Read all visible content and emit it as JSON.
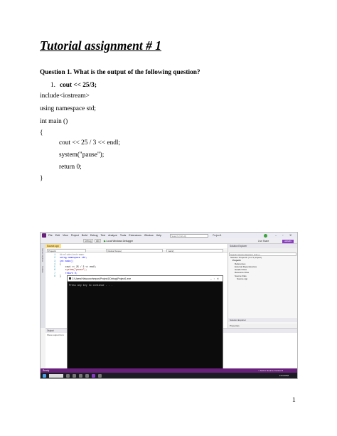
{
  "document": {
    "title": "Tutorial assignment # 1",
    "question": "Question 1. What is the output of the following question?",
    "list_item": {
      "number": "1.",
      "text": "cout << 25/3;"
    },
    "code_lines": [
      "include<iostream>",
      "using namespace std;",
      "int main ()",
      "{",
      "cout << 25 / 3 << endl;",
      "system(\"pause\");",
      "return 0;",
      "}"
    ],
    "page_number": "1"
  },
  "screenshot": {
    "menu_items": [
      "File",
      "Edit",
      "View",
      "Project",
      "Build",
      "Debug",
      "Test",
      "Analyze",
      "Tools",
      "Extensions",
      "Window",
      "Help"
    ],
    "search_placeholder": "Search (Ctrl+Q)",
    "project_name": "Project1",
    "toolbar": {
      "config": "Debug",
      "platform": "x86",
      "run_label": "Local Windows Debugger",
      "live_share": "Live Share",
      "admin": "ADMIN"
    },
    "left_tabs": [
      "Server Explorer",
      "Toolbox"
    ],
    "editor_tab": "Source.cpp",
    "nav_fields": [
      "Project1",
      "(Global Scope)",
      "main()"
    ],
    "code_rows": [
      {
        "n": "1",
        "text": "#include<iostream>"
      },
      {
        "n": "2",
        "text": "using namespace std;"
      },
      {
        "n": "3",
        "text": "int main()"
      },
      {
        "n": "4",
        "text": "{"
      },
      {
        "n": "5",
        "text": "    cout << 25 / 3 << endl;"
      },
      {
        "n": "6",
        "text": "    system(\"pause\");"
      },
      {
        "n": "7",
        "text": "    return 0;"
      },
      {
        "n": "8",
        "text": "}"
      }
    ],
    "console": {
      "title": "C:\\Users\\Ha\\source\\repos\\Project1\\Debug\\Project1.exe",
      "output": "Press any key to continue . . ."
    },
    "solution_explorer": {
      "header": "Solution Explorer",
      "search_placeholder": "Search Solution Explorer (Ctrl+;)",
      "items": [
        "Solution 'Project1' (1 of 1 project)",
        "Project1",
        "References",
        "External Dependencies",
        "Header Files",
        "Resource Files",
        "Source Files",
        "Source.cpp"
      ],
      "bottom_tab": "Solution Explorer",
      "properties_tab": "Properties"
    },
    "output_panel": {
      "header": "Output",
      "show_from": "Show output from:"
    },
    "status": {
      "ready": "Ready",
      "source_control": "↑ Add to Source Control ▾"
    },
    "clock": "12:19 PM"
  }
}
